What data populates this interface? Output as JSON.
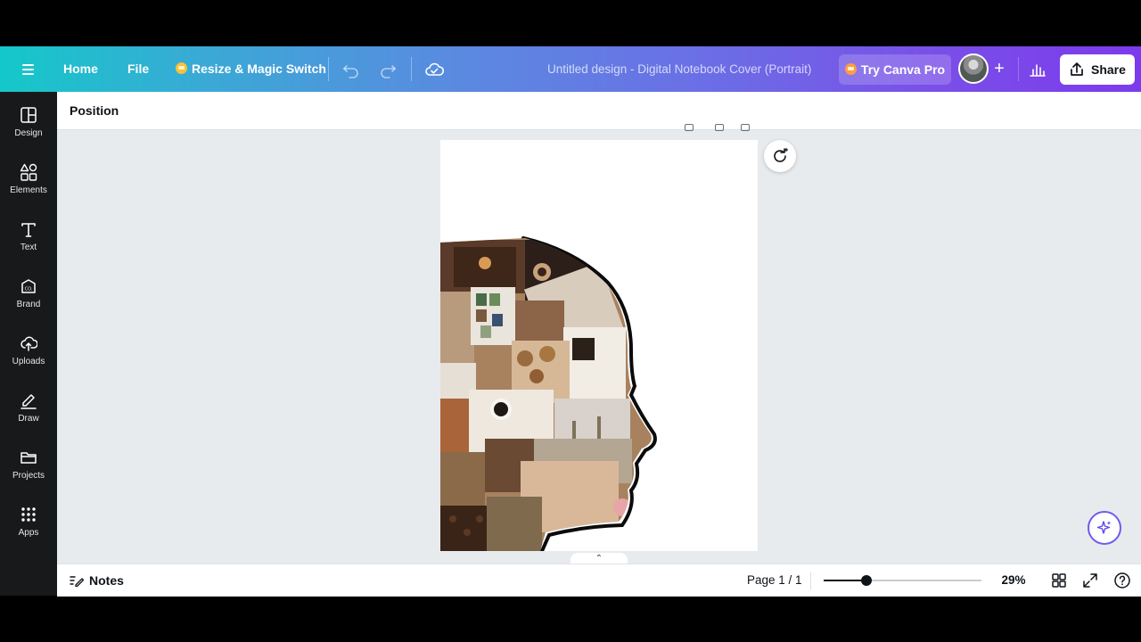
{
  "header": {
    "home_label": "Home",
    "file_label": "File",
    "resize_label": "Resize & Magic Switch",
    "document_title": "Untitled design - Digital Notebook Cover (Portrait)",
    "pro_label": "Try Canva Pro",
    "share_label": "Share"
  },
  "sidebar": {
    "items": [
      {
        "label": "Design",
        "icon": "layout-icon"
      },
      {
        "label": "Elements",
        "icon": "shapes-icon"
      },
      {
        "label": "Text",
        "icon": "text-t-icon"
      },
      {
        "label": "Brand",
        "icon": "brand-icon"
      },
      {
        "label": "Uploads",
        "icon": "cloud-upload-icon"
      },
      {
        "label": "Draw",
        "icon": "pen-icon"
      },
      {
        "label": "Projects",
        "icon": "folder-icon"
      },
      {
        "label": "Apps",
        "icon": "grid-icon"
      }
    ]
  },
  "context_toolbar": {
    "position_label": "Position"
  },
  "footer": {
    "notes_label": "Notes",
    "page_info": "Page 1 / 1",
    "zoom_level": "29%",
    "zoom_fraction": 0.27
  },
  "colors": {
    "gradient_start": "#14c8c9",
    "gradient_end": "#7c3aed",
    "sidebar_bg": "#18191b",
    "canvas_bg": "#e8ebee"
  }
}
